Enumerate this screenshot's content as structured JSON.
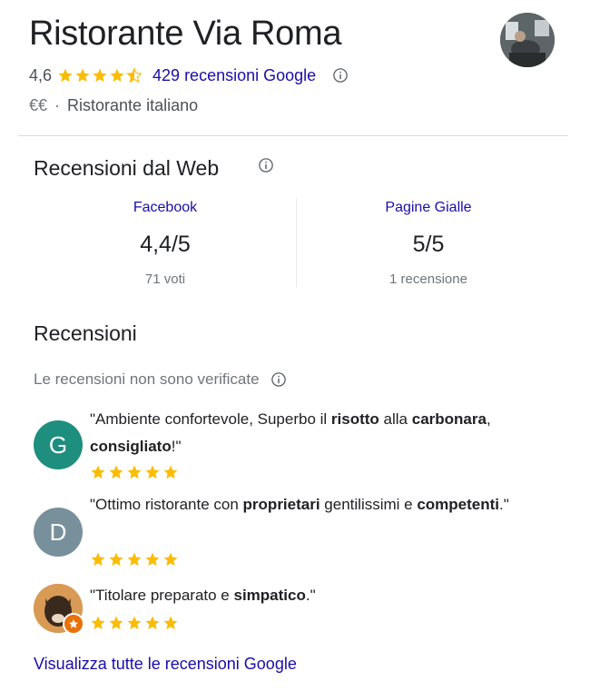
{
  "place": {
    "name": "Ristorante Via Roma",
    "rating": "4,6",
    "stars_fraction": 0.92,
    "reviews_link": "429 recensioni Google",
    "price": "€€",
    "separator": "·",
    "category": "Ristorante italiano"
  },
  "web_reviews": {
    "title": "Recensioni dal Web",
    "sources": [
      {
        "name": "Facebook",
        "score": "4,4/5",
        "count": "71 voti"
      },
      {
        "name": "Pagine Gialle",
        "score": "5/5",
        "count": "1 recensione"
      }
    ]
  },
  "reviews": {
    "title": "Recensioni",
    "unverified_note": "Le recensioni non sono verificate",
    "items": [
      {
        "avatar_letter": "G",
        "avatar_color": "#1e8e7e",
        "stars": 5,
        "text_parts": [
          {
            "t": "\"Ambiente confortevole, Superbo il ",
            "b": false
          },
          {
            "t": "risotto",
            "b": true
          },
          {
            "t": " alla ",
            "b": false
          },
          {
            "t": "carbonara",
            "b": true
          },
          {
            "t": ", ",
            "b": false
          },
          {
            "t": "consigliato",
            "b": true
          },
          {
            "t": "!\"",
            "b": false
          }
        ]
      },
      {
        "avatar_letter": "D",
        "avatar_color": "#78909c",
        "stars": 5,
        "text_parts": [
          {
            "t": "\"Ottimo ristorante con ",
            "b": false
          },
          {
            "t": "proprietari",
            "b": true
          },
          {
            "t": " gentilissimi e ",
            "b": false
          },
          {
            "t": "competenti",
            "b": true
          },
          {
            "t": ".\"",
            "b": false
          }
        ]
      },
      {
        "avatar_letter": "",
        "avatar_color": "#c8894a",
        "stars": 5,
        "text_parts": [
          {
            "t": "\"Titolare preparato e ",
            "b": false
          },
          {
            "t": "simpatico",
            "b": true
          },
          {
            "t": ".\"",
            "b": false
          }
        ]
      }
    ],
    "all_link": "Visualizza tutte le recensioni Google"
  },
  "colors": {
    "star": "#fbbc04",
    "link": "#1a0dab",
    "badge": "#e8710a"
  },
  "icons": {
    "info": "info-circle-icon",
    "star": "star-icon",
    "local-guide-badge": "local-guide-badge-icon"
  }
}
